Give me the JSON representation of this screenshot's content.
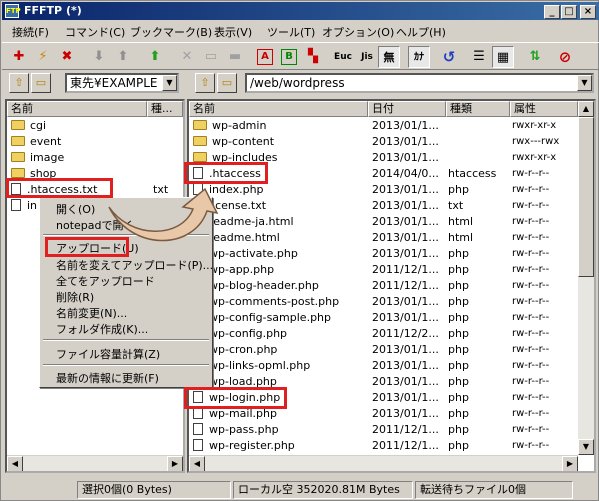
{
  "window": {
    "title": "FFFTP (*)"
  },
  "menu": [
    "接続(F)",
    "コマンド(C)",
    "ブックマーク(B)",
    "表示(V)",
    "ツール(T)",
    "オプション(O)",
    "ヘルプ(H)"
  ],
  "toolbar": {
    "buttons": [
      {
        "name": "connect-icon",
        "glyph": "✚",
        "color": "#cc0000"
      },
      {
        "name": "quick-connect-icon",
        "glyph": "⚡",
        "color": "#cc8800"
      },
      {
        "name": "disconnect-icon",
        "glyph": "✖",
        "color": "#cc0000"
      },
      {
        "name": "download-icon",
        "glyph": "⬇",
        "color": "#909090"
      },
      {
        "name": "upload-icon",
        "glyph": "⬆",
        "color": "#909090"
      },
      {
        "name": "mirror-upload-icon",
        "glyph": "⬆",
        "color": "#20a020"
      },
      {
        "name": "delete-icon",
        "glyph": "✕",
        "color": "#a0a0a0"
      },
      {
        "name": "rename-icon",
        "glyph": "▭",
        "color": "#a0a0a0"
      },
      {
        "name": "make-dir-icon",
        "glyph": "▬",
        "color": "#a0a0a0"
      },
      {
        "name": "ascii-mode-icon",
        "glyph": "A",
        "color": "#cc0000"
      },
      {
        "name": "binary-mode-icon",
        "glyph": "B",
        "color": "#008800"
      },
      {
        "name": "auto-mode-icon",
        "glyph": "▚",
        "color": "#cc0000"
      },
      {
        "name": "euc-icon",
        "glyph": "Euc",
        "color": "#000000"
      },
      {
        "name": "jis-icon",
        "glyph": "Jis",
        "color": "#000000"
      },
      {
        "name": "no-convert-icon",
        "glyph": "無",
        "color": "#000000"
      },
      {
        "name": "kana-icon",
        "glyph": "ｶﾅ",
        "color": "#000000"
      },
      {
        "name": "refresh-icon",
        "glyph": "↺",
        "color": "#2040c0"
      },
      {
        "name": "list-view-icon",
        "glyph": "☰",
        "color": "#000000"
      },
      {
        "name": "detail-view-icon",
        "glyph": "▦",
        "color": "#000000"
      },
      {
        "name": "sync-browse-icon",
        "glyph": "⇅",
        "color": "#20a020"
      },
      {
        "name": "stop-icon",
        "glyph": "⊘",
        "color": "#cc0000"
      }
    ]
  },
  "local": {
    "path": "東先¥EXAMPLE",
    "columns": [
      "名前",
      "種..."
    ],
    "files": [
      {
        "name": "cgi",
        "type": "",
        "kind": "folder"
      },
      {
        "name": "event",
        "type": "",
        "kind": "folder"
      },
      {
        "name": "image",
        "type": "",
        "kind": "folder"
      },
      {
        "name": "shop",
        "type": "",
        "kind": "folder"
      },
      {
        "name": ".htaccess.txt",
        "type": "txt",
        "kind": "file"
      },
      {
        "name": "in",
        "type": "",
        "kind": "file"
      }
    ]
  },
  "remote": {
    "path": "/web/wordpress",
    "columns": [
      "名前",
      "日付",
      "種類",
      "属性"
    ],
    "files": [
      {
        "name": "wp-admin",
        "date": "2013/01/1...",
        "type": "",
        "attr": "rwxr-xr-x",
        "kind": "folder"
      },
      {
        "name": "wp-content",
        "date": "2013/01/1...",
        "type": "",
        "attr": "rwx---rwx",
        "kind": "folder"
      },
      {
        "name": "wp-includes",
        "date": "2013/01/1...",
        "type": "",
        "attr": "rwxr-xr-x",
        "kind": "folder"
      },
      {
        "name": ".htaccess",
        "date": "2014/04/0...",
        "type": "htaccess",
        "attr": "rw-r--r--",
        "kind": "file"
      },
      {
        "name": "index.php",
        "date": "2013/01/1...",
        "type": "php",
        "attr": "rw-r--r--",
        "kind": "file"
      },
      {
        "name": "license.txt",
        "date": "2013/01/1...",
        "type": "txt",
        "attr": "rw-r--r--",
        "kind": "file"
      },
      {
        "name": "readme-ja.html",
        "date": "2013/01/1...",
        "type": "html",
        "attr": "rw-r--r--",
        "kind": "file"
      },
      {
        "name": "readme.html",
        "date": "2013/01/1...",
        "type": "html",
        "attr": "rw-r--r--",
        "kind": "file"
      },
      {
        "name": "wp-activate.php",
        "date": "2013/01/1...",
        "type": "php",
        "attr": "rw-r--r--",
        "kind": "file"
      },
      {
        "name": "wp-app.php",
        "date": "2011/12/1...",
        "type": "php",
        "attr": "rw-r--r--",
        "kind": "file"
      },
      {
        "name": "wp-blog-header.php",
        "date": "2011/12/1...",
        "type": "php",
        "attr": "rw-r--r--",
        "kind": "file"
      },
      {
        "name": "wp-comments-post.php",
        "date": "2013/01/1...",
        "type": "php",
        "attr": "rw-r--r--",
        "kind": "file"
      },
      {
        "name": "wp-config-sample.php",
        "date": "2013/01/1...",
        "type": "php",
        "attr": "rw-r--r--",
        "kind": "file"
      },
      {
        "name": "wp-config.php",
        "date": "2011/12/2...",
        "type": "php",
        "attr": "rw-r--r--",
        "kind": "file"
      },
      {
        "name": "wp-cron.php",
        "date": "2013/01/1...",
        "type": "php",
        "attr": "rw-r--r--",
        "kind": "file"
      },
      {
        "name": "wp-links-opml.php",
        "date": "2013/01/1...",
        "type": "php",
        "attr": "rw-r--r--",
        "kind": "file"
      },
      {
        "name": "wp-load.php",
        "date": "2013/01/1...",
        "type": "php",
        "attr": "rw-r--r--",
        "kind": "file"
      },
      {
        "name": "wp-login.php",
        "date": "2013/01/1...",
        "type": "php",
        "attr": "rw-r--r--",
        "kind": "file"
      },
      {
        "name": "wp-mail.php",
        "date": "2013/01/1...",
        "type": "php",
        "attr": "rw-r--r--",
        "kind": "file"
      },
      {
        "name": "wp-pass.php",
        "date": "2011/12/1...",
        "type": "php",
        "attr": "rw-r--r--",
        "kind": "file"
      },
      {
        "name": "wp-register.php",
        "date": "2011/12/1...",
        "type": "php",
        "attr": "rw-r--r--",
        "kind": "file"
      }
    ]
  },
  "context_menu": {
    "items": [
      "開く(O)",
      "notepadで開く",
      "アップロード(U)",
      "名前を変えてアップロード(P)...",
      "全てをアップロード",
      "削除(R)",
      "名前変更(N)...",
      "フォルダ作成(K)...",
      "ファイル容量計算(Z)",
      "最新の情報に更新(F)"
    ]
  },
  "status": {
    "selection": "選択0個(0 Bytes)",
    "local_free": "ローカル空 352020.81M Bytes",
    "queue": "転送待ちファイル0個"
  },
  "colors": {
    "highlight": "#e02020",
    "titlebar": "#0a246a",
    "arrow": "#e8c8a8"
  }
}
